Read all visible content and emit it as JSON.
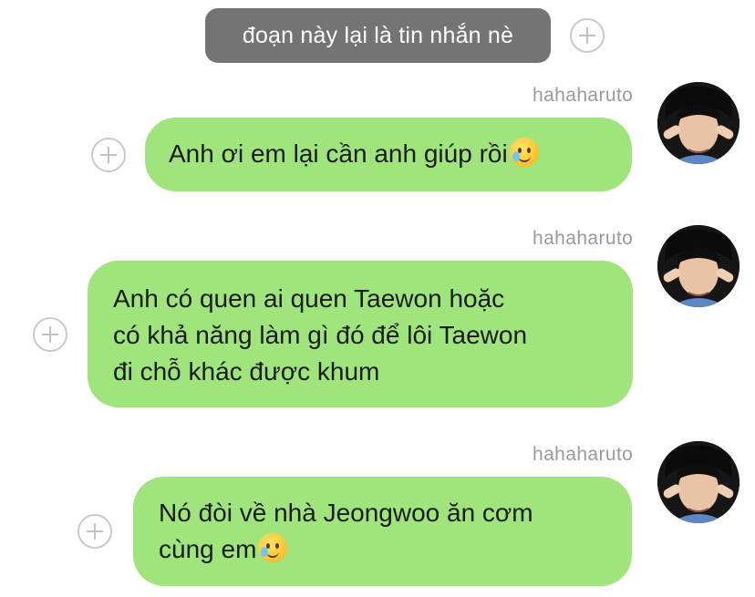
{
  "system_message": {
    "text": "đoạn này lại là tin nhắn nè"
  },
  "messages": [
    {
      "sender": "hahaharuto",
      "text": "Anh ơi em lại cần anh giúp rồi",
      "emoji": "crying-smile-emoji"
    },
    {
      "sender": "hahaharuto",
      "text": "Anh có quen ai quen Taewon hoặc\ncó khả năng làm gì đó để lôi Taewon\nđi chỗ khác được khum",
      "emoji": ""
    },
    {
      "sender": "hahaharuto",
      "text": "Nó đòi về nhà Jeongwoo ăn cơm\ncùng em",
      "emoji": "crying-smile-emoji"
    }
  ],
  "icons": {
    "add": "plus-circle-icon",
    "emoji": "crying-smile-emoji"
  },
  "colors": {
    "bubble_green": "#9fe57c",
    "system_grey": "#747474",
    "sender_name_grey": "#9a9a9a"
  }
}
